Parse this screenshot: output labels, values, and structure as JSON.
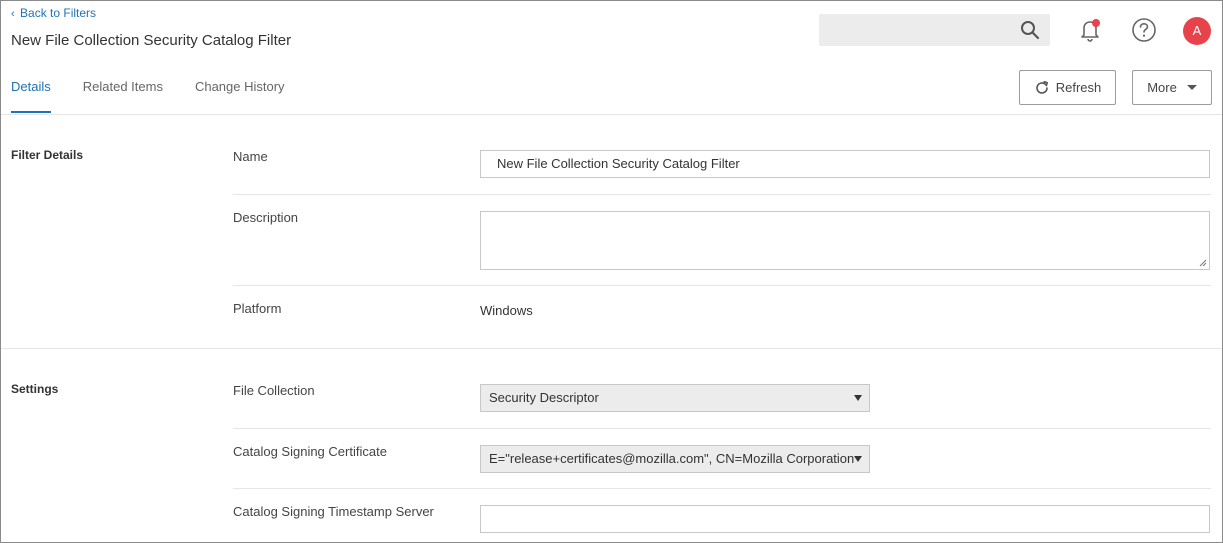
{
  "header": {
    "back_link": "Back to Filters",
    "title": "New File Collection Security Catalog Filter",
    "avatar_initial": "A"
  },
  "tabs": [
    {
      "label": "Details",
      "active": true
    },
    {
      "label": "Related Items",
      "active": false
    },
    {
      "label": "Change History",
      "active": false
    }
  ],
  "toolbar": {
    "refresh_label": "Refresh",
    "more_label": "More"
  },
  "filter_details": {
    "section_title": "Filter Details",
    "name_label": "Name",
    "name_value": "New File Collection Security Catalog Filter",
    "description_label": "Description",
    "description_value": "",
    "platform_label": "Platform",
    "platform_value": "Windows"
  },
  "settings": {
    "section_title": "Settings",
    "file_collection_label": "File Collection",
    "file_collection_value": "Security Descriptor",
    "catalog_cert_label": "Catalog Signing Certificate",
    "catalog_cert_value": "E=\"release+certificates@mozilla.com\", CN=Mozilla Corporation",
    "timestamp_label": "Catalog Signing Timestamp Server",
    "timestamp_value": ""
  },
  "icons": {
    "search": "search-icon",
    "notifications": "bell-icon",
    "help": "help-icon",
    "refresh": "refresh-icon"
  },
  "colors": {
    "accent": "#1f73b7",
    "notification_dot": "#e8434b",
    "avatar_bg": "#e8434b"
  }
}
